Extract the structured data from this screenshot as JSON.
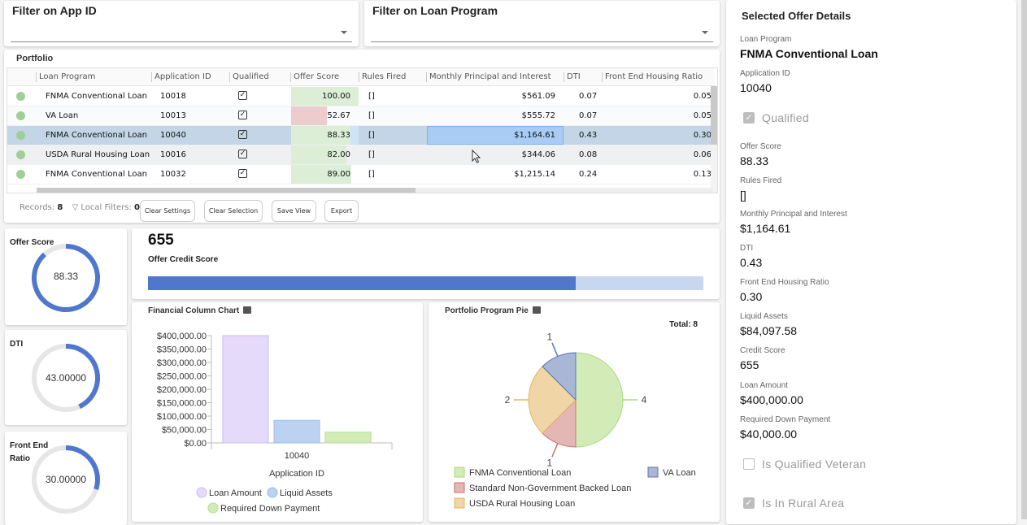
{
  "filters": {
    "app_id": {
      "title": "Filter on App ID",
      "value": ""
    },
    "loan_program": {
      "title": "Filter on Loan Program",
      "value": ""
    }
  },
  "portfolio": {
    "title": "Portfolio",
    "columns": [
      "Loan Program",
      "Application ID",
      "Qualified",
      "Offer Score",
      "Rules Fired",
      "Monthly Principal and Interest",
      "DTI",
      "Front End Housing Ratio"
    ],
    "rows": [
      {
        "loan_program": "FNMA Conventional Loan",
        "app_id": "10018",
        "qualified": true,
        "offer_score": "100.00",
        "score_pct": 100,
        "score_color": "#dcefd6",
        "rules": "[]",
        "mpi": "$561.09",
        "dti": "0.07",
        "fehr": "0.05",
        "selected": false
      },
      {
        "loan_program": "VA Loan",
        "app_id": "10013",
        "qualified": true,
        "offer_score": "52.67",
        "score_pct": 52.67,
        "score_color": "#eccccc",
        "rules": "[]",
        "mpi": "$555.72",
        "dti": "0.07",
        "fehr": "0.05",
        "selected": false
      },
      {
        "loan_program": "FNMA Conventional Loan",
        "app_id": "10040",
        "qualified": true,
        "offer_score": "88.33",
        "score_pct": 88.33,
        "score_color": "#dcefd6",
        "rules": "[]",
        "mpi": "$1,164.61",
        "dti": "0.43",
        "fehr": "0.30",
        "selected": true
      },
      {
        "loan_program": "USDA Rural Housing Loan",
        "app_id": "10016",
        "qualified": true,
        "offer_score": "82.00",
        "score_pct": 82,
        "score_color": "#dcefd6",
        "rules": "[]",
        "mpi": "$344.06",
        "dti": "0.08",
        "fehr": "0.06",
        "selected": false
      },
      {
        "loan_program": "FNMA Conventional Loan",
        "app_id": "10032",
        "qualified": true,
        "offer_score": "89.00",
        "score_pct": 89,
        "score_color": "#dcefd6",
        "rules": "[]",
        "mpi": "$1,215.14",
        "dti": "0.24",
        "fehr": "0.13",
        "selected": false
      }
    ],
    "footer": {
      "records_label": "Records:",
      "records_value": "8",
      "filters_label": "Local Filters:",
      "filters_value": "0",
      "clear_settings": "Clear Settings",
      "clear_selection": "Clear Selection",
      "save_view": "Save View",
      "export": "Export"
    }
  },
  "gauges": [
    {
      "title": "Offer Score",
      "display": "88.33",
      "fraction": 0.8833
    },
    {
      "title": "DTI",
      "display": "43.00000",
      "fraction": 0.43
    },
    {
      "title": "Front End Ratio",
      "display": "30.00000",
      "fraction": 0.3
    }
  ],
  "credit_score": {
    "value": "655",
    "label": "Offer Credit Score",
    "fraction": 0.77
  },
  "colors": {
    "accent": "#4f78cd",
    "accent_light": "#c9d6ef",
    "selected_row": "#c3d5e6",
    "selected_cell": "#a9ccf5"
  },
  "chart_data": [
    {
      "type": "bar",
      "title": "Financial Column Chart",
      "categories": [
        "10040"
      ],
      "xlabel": "Application ID",
      "ylabel": "",
      "ylim": [
        0,
        400000
      ],
      "yticks": [
        "$0.00",
        "$50,000.00",
        "$100,000.00",
        "$150,000.00",
        "$200,000.00",
        "$250,000.00",
        "$300,000.00",
        "$350,000.00",
        "$400,000.00"
      ],
      "series": [
        {
          "name": "Loan Amount",
          "values": [
            400000
          ],
          "color": "#e6dafa",
          "stroke": "#cdb9f2"
        },
        {
          "name": "Liquid Assets",
          "values": [
            84097.58
          ],
          "color": "#bcd2f1",
          "stroke": "#9bbbe9"
        },
        {
          "name": "Required Down Payment",
          "values": [
            40000
          ],
          "color": "#d3ecb7",
          "stroke": "#b5dc8f"
        }
      ],
      "legend": "bottom"
    },
    {
      "type": "pie",
      "title": "Portfolio Program Pie",
      "total_label": "Total: 8",
      "slices": [
        {
          "name": "FNMA Conventional Loan",
          "value": 4,
          "color": "#d3ecb7",
          "stroke": "#a8d87e"
        },
        {
          "name": "Standard Non-Government Backed Loan",
          "value": 1,
          "color": "#e3b7b4",
          "stroke": "#c9726a"
        },
        {
          "name": "USDA Rural Housing Loan",
          "value": 2,
          "color": "#f0d6a6",
          "stroke": "#e6b55f"
        },
        {
          "name": "VA Loan",
          "value": 1,
          "color": "#a9b6d4",
          "stroke": "#5b74b8"
        }
      ],
      "legend": "bottom"
    }
  ],
  "details": {
    "title": "Selected Offer Details",
    "fields": [
      {
        "label": "Loan Program",
        "value": "FNMA Conventional Loan"
      },
      {
        "label": "Application ID",
        "value": "10040"
      },
      {
        "label": "Offer Score",
        "value": "88.33"
      },
      {
        "label": "Rules Fired",
        "value": "[]"
      },
      {
        "label": "Monthly Principal and Interest",
        "value": "$1,164.61"
      },
      {
        "label": "DTI",
        "value": "0.43"
      },
      {
        "label": "Front End Housing Ratio",
        "value": "0.30"
      },
      {
        "label": "Liquid Assets",
        "value": "$84,097.58"
      },
      {
        "label": "Credit Score",
        "value": "655"
      },
      {
        "label": "Loan Amount",
        "value": "$400,000.00"
      },
      {
        "label": "Required Down Payment",
        "value": "$40,000.00"
      }
    ],
    "checkboxes": [
      {
        "label": "Qualified",
        "checked": true
      },
      {
        "label": "Is Qualified Veteran",
        "checked": false
      },
      {
        "label": "Is In Rural Area",
        "checked": true
      }
    ]
  }
}
